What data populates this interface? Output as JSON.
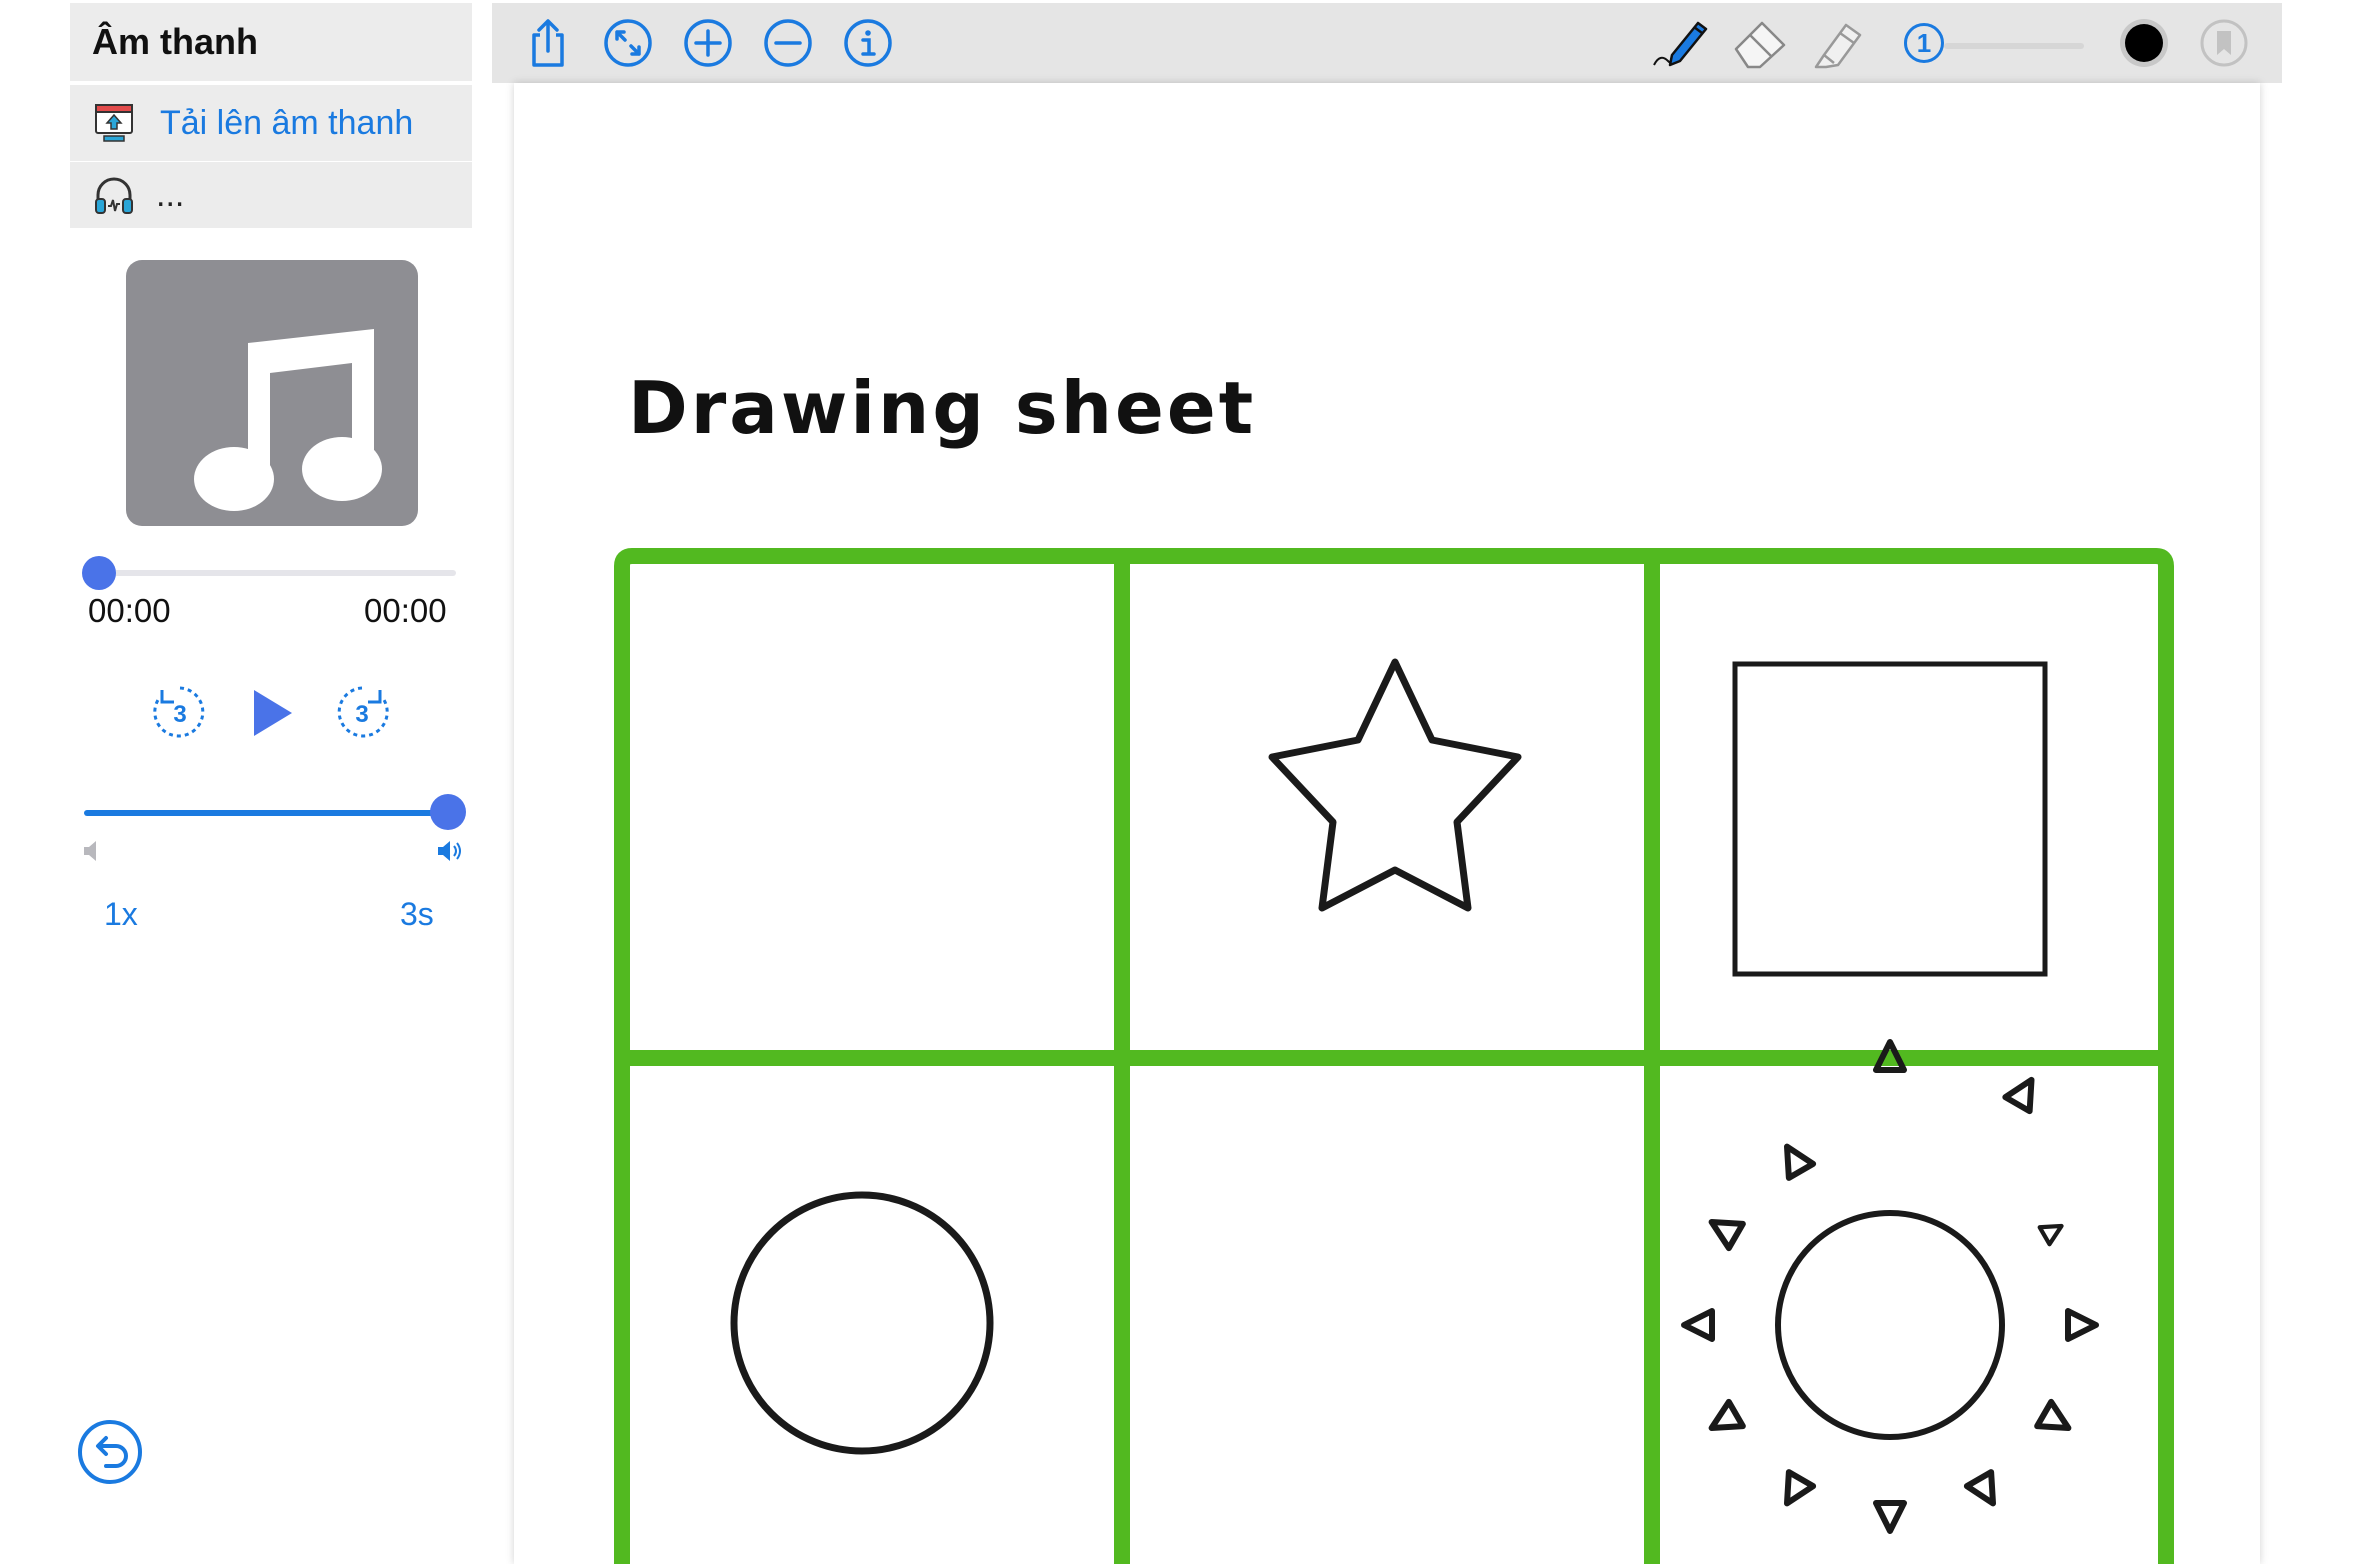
{
  "sidebar": {
    "title": "Âm thanh",
    "upload_label": "Tải lên âm thanh",
    "more_label": "..."
  },
  "player": {
    "current_time": "00:00",
    "duration": "00:00",
    "rewind_seconds": "3",
    "forward_seconds": "3",
    "progress_fraction": 0,
    "volume_fraction": 1.0,
    "speed_label": "1x",
    "skip_label": "3s"
  },
  "toolbar": {
    "icons": [
      "share-icon",
      "fit-icon",
      "zoom-in-icon",
      "zoom-out-icon",
      "info-icon",
      "pen-icon",
      "eraser-icon",
      "highlighter-icon",
      "bookmark-icon"
    ],
    "stroke_width": "1",
    "ink_color": "#000000"
  },
  "document": {
    "title": "Drawing sheet",
    "grid_color": "#52b920",
    "shapes": [
      "empty",
      "star",
      "square",
      "circle",
      "empty",
      "sun"
    ]
  },
  "colors": {
    "accent": "#1a7ae0",
    "knob": "#4a73e8",
    "panel_bg": "#ececec",
    "album_bg": "#8e8e93"
  }
}
